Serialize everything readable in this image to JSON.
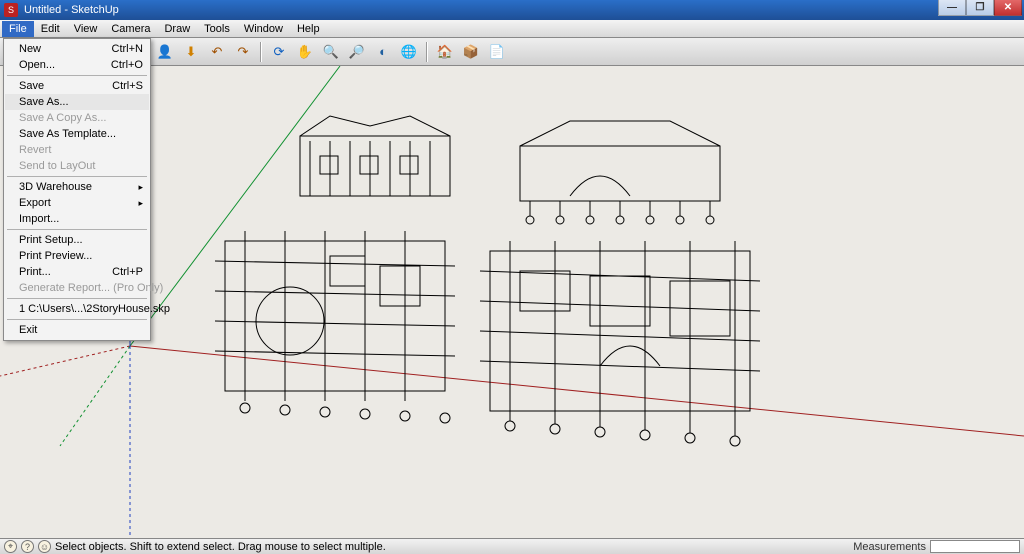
{
  "window": {
    "title": "Untitled - SketchUp"
  },
  "menubar": {
    "items": [
      "File",
      "Edit",
      "View",
      "Camera",
      "Draw",
      "Tools",
      "Window",
      "Help"
    ]
  },
  "toolbar": {
    "icons": [
      {
        "name": "person-icon",
        "glyph": "👤",
        "color": "#c02020"
      },
      {
        "name": "download-icon",
        "glyph": "⬇",
        "color": "#d08000"
      },
      {
        "name": "undo-icon",
        "glyph": "↶",
        "color": "#a05000"
      },
      {
        "name": "redo-icon",
        "glyph": "↷",
        "color": "#a05000"
      },
      {
        "name": "separator"
      },
      {
        "name": "orbit-icon",
        "glyph": "⟳",
        "color": "#1060c0"
      },
      {
        "name": "pan-icon",
        "glyph": "✋",
        "color": "#b08030"
      },
      {
        "name": "zoom-icon",
        "glyph": "🔍",
        "color": "#406080"
      },
      {
        "name": "zoom-extents-icon",
        "glyph": "🔎",
        "color": "#406080"
      },
      {
        "name": "previous-view-icon",
        "glyph": "◐",
        "color": "#2060a0"
      },
      {
        "name": "globe-icon",
        "glyph": "🌐",
        "color": "#1060c0"
      },
      {
        "name": "separator"
      },
      {
        "name": "warehouse-icon",
        "glyph": "🏠",
        "color": "#c08000"
      },
      {
        "name": "component-icon",
        "glyph": "📦",
        "color": "#c08000"
      },
      {
        "name": "layout-icon",
        "glyph": "📄",
        "color": "#c08000"
      }
    ]
  },
  "fileMenu": {
    "items": [
      {
        "label": "New",
        "shortcut": "Ctrl+N",
        "enabled": true
      },
      {
        "label": "Open...",
        "shortcut": "Ctrl+O",
        "enabled": true
      },
      {
        "sep": true
      },
      {
        "label": "Save",
        "shortcut": "Ctrl+S",
        "enabled": true
      },
      {
        "label": "Save As...",
        "enabled": true,
        "hovered": true
      },
      {
        "label": "Save A Copy As...",
        "enabled": false
      },
      {
        "label": "Save As Template...",
        "enabled": true
      },
      {
        "label": "Revert",
        "enabled": false
      },
      {
        "label": "Send to LayOut",
        "enabled": false
      },
      {
        "sep": true
      },
      {
        "label": "3D Warehouse",
        "enabled": true,
        "submenu": true
      },
      {
        "label": "Export",
        "enabled": true,
        "submenu": true
      },
      {
        "label": "Import...",
        "enabled": true
      },
      {
        "sep": true
      },
      {
        "label": "Print Setup...",
        "enabled": true
      },
      {
        "label": "Print Preview...",
        "enabled": true
      },
      {
        "label": "Print...",
        "shortcut": "Ctrl+P",
        "enabled": true
      },
      {
        "label": "Generate Report... (Pro Only)",
        "enabled": false
      },
      {
        "sep": true
      },
      {
        "label": "1 C:\\Users\\...\\2StoryHouse.skp",
        "enabled": true
      },
      {
        "sep": true
      },
      {
        "label": "Exit",
        "enabled": true
      }
    ]
  },
  "status": {
    "hint": "Select objects. Shift to extend select. Drag mouse to select multiple.",
    "measurementsLabel": "Measurements"
  }
}
